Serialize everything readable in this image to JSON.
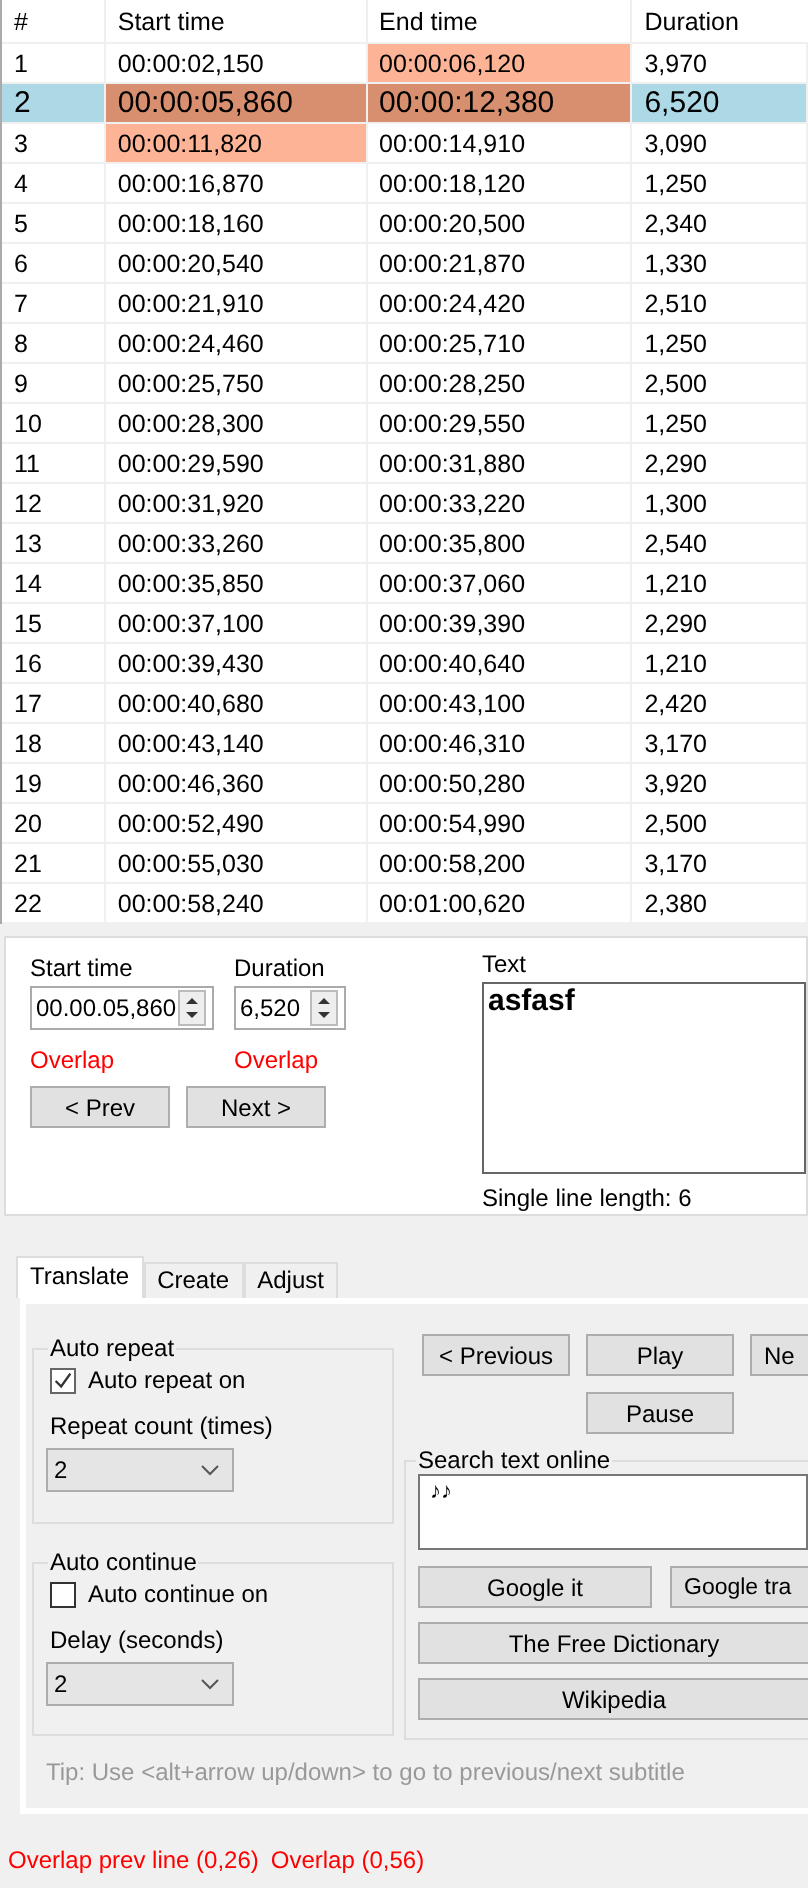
{
  "table": {
    "columns": [
      "#",
      "Start time",
      "End time",
      "Duration"
    ],
    "rows": [
      {
        "num": "1",
        "start": "00:00:02,150",
        "end": "00:00:06,120",
        "duration": "3,970",
        "selected": false,
        "start_overlap": false,
        "end_overlap": true
      },
      {
        "num": "2",
        "start": "00:00:05,860",
        "end": "00:00:12,380",
        "duration": "6,520",
        "selected": true,
        "start_overlap": true,
        "end_overlap": true
      },
      {
        "num": "3",
        "start": "00:00:11,820",
        "end": "00:00:14,910",
        "duration": "3,090",
        "selected": false,
        "start_overlap": true,
        "end_overlap": false
      },
      {
        "num": "4",
        "start": "00:00:16,870",
        "end": "00:00:18,120",
        "duration": "1,250",
        "selected": false,
        "start_overlap": false,
        "end_overlap": false
      },
      {
        "num": "5",
        "start": "00:00:18,160",
        "end": "00:00:20,500",
        "duration": "2,340",
        "selected": false,
        "start_overlap": false,
        "end_overlap": false
      },
      {
        "num": "6",
        "start": "00:00:20,540",
        "end": "00:00:21,870",
        "duration": "1,330",
        "selected": false,
        "start_overlap": false,
        "end_overlap": false
      },
      {
        "num": "7",
        "start": "00:00:21,910",
        "end": "00:00:24,420",
        "duration": "2,510",
        "selected": false,
        "start_overlap": false,
        "end_overlap": false
      },
      {
        "num": "8",
        "start": "00:00:24,460",
        "end": "00:00:25,710",
        "duration": "1,250",
        "selected": false,
        "start_overlap": false,
        "end_overlap": false
      },
      {
        "num": "9",
        "start": "00:00:25,750",
        "end": "00:00:28,250",
        "duration": "2,500",
        "selected": false,
        "start_overlap": false,
        "end_overlap": false
      },
      {
        "num": "10",
        "start": "00:00:28,300",
        "end": "00:00:29,550",
        "duration": "1,250",
        "selected": false,
        "start_overlap": false,
        "end_overlap": false
      },
      {
        "num": "11",
        "start": "00:00:29,590",
        "end": "00:00:31,880",
        "duration": "2,290",
        "selected": false,
        "start_overlap": false,
        "end_overlap": false
      },
      {
        "num": "12",
        "start": "00:00:31,920",
        "end": "00:00:33,220",
        "duration": "1,300",
        "selected": false,
        "start_overlap": false,
        "end_overlap": false
      },
      {
        "num": "13",
        "start": "00:00:33,260",
        "end": "00:00:35,800",
        "duration": "2,540",
        "selected": false,
        "start_overlap": false,
        "end_overlap": false
      },
      {
        "num": "14",
        "start": "00:00:35,850",
        "end": "00:00:37,060",
        "duration": "1,210",
        "selected": false,
        "start_overlap": false,
        "end_overlap": false
      },
      {
        "num": "15",
        "start": "00:00:37,100",
        "end": "00:00:39,390",
        "duration": "2,290",
        "selected": false,
        "start_overlap": false,
        "end_overlap": false
      },
      {
        "num": "16",
        "start": "00:00:39,430",
        "end": "00:00:40,640",
        "duration": "1,210",
        "selected": false,
        "start_overlap": false,
        "end_overlap": false
      },
      {
        "num": "17",
        "start": "00:00:40,680",
        "end": "00:00:43,100",
        "duration": "2,420",
        "selected": false,
        "start_overlap": false,
        "end_overlap": false
      },
      {
        "num": "18",
        "start": "00:00:43,140",
        "end": "00:00:46,310",
        "duration": "3,170",
        "selected": false,
        "start_overlap": false,
        "end_overlap": false
      },
      {
        "num": "19",
        "start": "00:00:46,360",
        "end": "00:00:50,280",
        "duration": "3,920",
        "selected": false,
        "start_overlap": false,
        "end_overlap": false
      },
      {
        "num": "20",
        "start": "00:00:52,490",
        "end": "00:00:54,990",
        "duration": "2,500",
        "selected": false,
        "start_overlap": false,
        "end_overlap": false
      },
      {
        "num": "21",
        "start": "00:00:55,030",
        "end": "00:00:58,200",
        "duration": "3,170",
        "selected": false,
        "start_overlap": false,
        "end_overlap": false
      },
      {
        "num": "22",
        "start": "00:00:58,240",
        "end": "00:01:00,620",
        "duration": "2,380",
        "selected": false,
        "start_overlap": false,
        "end_overlap": false
      }
    ]
  },
  "editor": {
    "start_label": "Start time",
    "start_value": "00.00.05,860",
    "start_warning": "Overlap",
    "duration_label": "Duration",
    "duration_value": "6,520",
    "duration_warning": "Overlap",
    "prev_button": "< Prev",
    "next_button": "Next >",
    "text_label": "Text",
    "text_value": "asfasf",
    "line_length": "Single line length: 6"
  },
  "tabs": [
    {
      "label": "Translate",
      "selected": true
    },
    {
      "label": "Create",
      "selected": false
    },
    {
      "label": "Adjust",
      "selected": false
    }
  ],
  "auto_repeat": {
    "title": "Auto repeat",
    "checkbox": "Auto repeat on",
    "checked": true,
    "count_label": "Repeat count (times)",
    "count_value": "2"
  },
  "auto_continue": {
    "title": "Auto continue",
    "checkbox": "Auto continue on",
    "checked": false,
    "delay_label": "Delay (seconds)",
    "delay_value": "2"
  },
  "playback_buttons": [
    "< Previous",
    "Play",
    "Ne",
    "Pause"
  ],
  "search": {
    "title": "Search text online",
    "text": "♪♪",
    "buttons": [
      "Google it",
      "Google tra",
      "The Free Dictionary",
      "Wikipedia"
    ]
  },
  "tip": "Tip: Use <alt+arrow up/down> to go to previous/next subtitle",
  "status_bar": [
    "Overlap prev line (0,26)",
    "Overlap (0,56)"
  ]
}
